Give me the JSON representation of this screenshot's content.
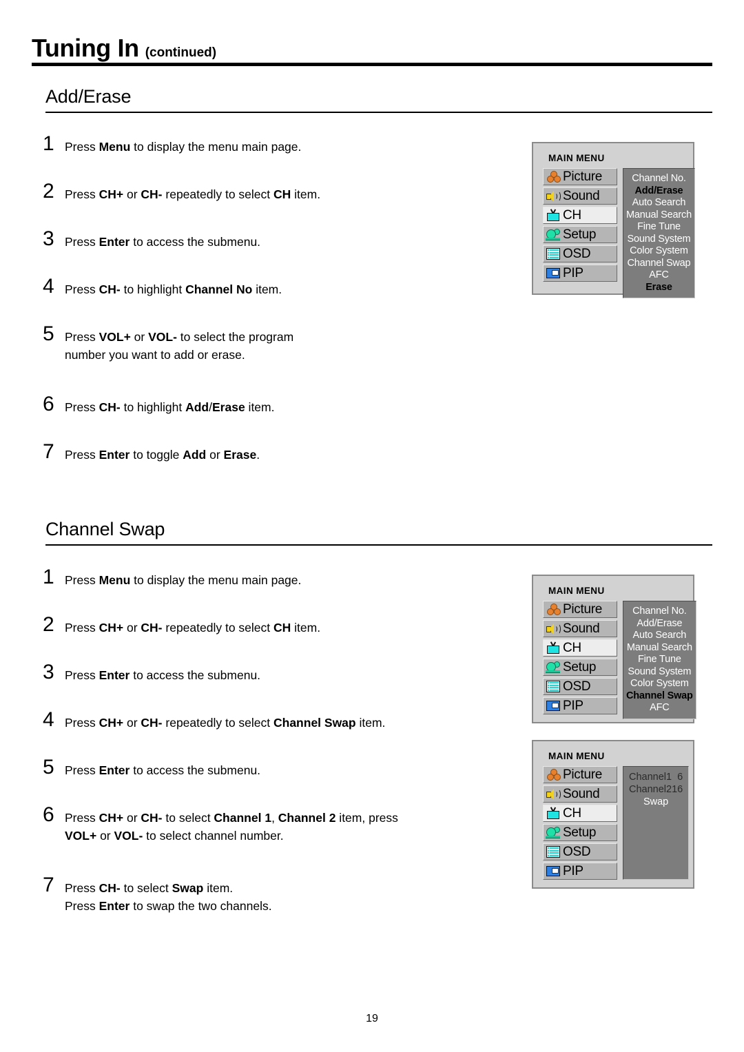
{
  "header": {
    "title": "Tuning In",
    "subtitle": "(continued)"
  },
  "sections": [
    {
      "id": "add-erase",
      "title": "Add/Erase",
      "steps": [
        {
          "num": "1",
          "html": "Press <b>Menu</b> to display the menu main page."
        },
        {
          "num": "2",
          "html": "Press <b>CH+</b> or <b>CH-</b> repeatedly to select <b>CH</b> item."
        },
        {
          "num": "3",
          "html": "Press <b>Enter</b> to access the submenu."
        },
        {
          "num": "4",
          "html": "Press <b>CH-</b> to highlight <b>Channel No</b> item."
        },
        {
          "num": "5",
          "html": "Press <b>VOL+</b> or <b>VOL-</b> to select the program",
          "line2": "number you want to add or erase."
        },
        {
          "num": "6",
          "html": "Press <b>CH-</b> to highlight <b>Add</b>/<b>Erase</b> item."
        },
        {
          "num": "7",
          "html": "Press <b>Enter</b> to toggle <b>Add</b> or <b>Erase</b>."
        }
      ]
    },
    {
      "id": "channel-swap",
      "title": "Channel Swap",
      "steps": [
        {
          "num": "1",
          "html": "Press <b>Menu</b> to display the menu main page."
        },
        {
          "num": "2",
          "html": "Press <b>CH+</b> or <b>CH-</b> repeatedly to select <b>CH</b> item."
        },
        {
          "num": "3",
          "html": "Press <b>Enter</b> to access the submenu."
        },
        {
          "num": "4",
          "html": "Press <b>CH+</b> or <b>CH-</b> repeatedly to select <b>Channel Swap</b> item."
        },
        {
          "num": "5",
          "html": "Press <b>Enter</b> to access the submenu."
        },
        {
          "num": "6",
          "html": "Press <b>CH+</b> or <b>CH-</b> to select <b>Channel 1</b>, <b>Channel 2</b> item, press",
          "line2": "<b>VOL+</b> or <b>VOL-</b> to select channel number."
        },
        {
          "num": "7",
          "html": "Press <b>CH-</b> to select <b>Swap</b> item.",
          "line2": "Press <b>Enter</b> to swap the two channels."
        }
      ]
    }
  ],
  "osd_menus": [
    {
      "id": "osd-add-erase",
      "title": "MAIN MENU",
      "buttons": [
        {
          "label": "Picture",
          "icon": "picture-icon",
          "selected": false
        },
        {
          "label": "Sound",
          "icon": "sound-icon",
          "selected": false
        },
        {
          "label": "CH",
          "icon": "ch-icon",
          "selected": true
        },
        {
          "label": "Setup",
          "icon": "setup-icon",
          "selected": false
        },
        {
          "label": "OSD",
          "icon": "osd-icon",
          "selected": false
        },
        {
          "label": "PIP",
          "icon": "pip-icon",
          "selected": false
        }
      ],
      "submenu": [
        {
          "label": "Channel No.",
          "highlighted": false
        },
        {
          "label": "Add/Erase",
          "highlighted": true
        },
        {
          "label": "Auto Search",
          "highlighted": false
        },
        {
          "label": "Manual Search",
          "highlighted": false
        },
        {
          "label": "Fine Tune",
          "highlighted": false
        },
        {
          "label": "Sound System",
          "highlighted": false
        },
        {
          "label": "Color System",
          "highlighted": false
        },
        {
          "label": "Channel Swap",
          "highlighted": false
        },
        {
          "label": "AFC",
          "highlighted": false
        },
        {
          "label": "Erase",
          "highlighted": true
        }
      ]
    },
    {
      "id": "osd-channel-swap",
      "title": "MAIN MENU",
      "buttons": [
        {
          "label": "Picture",
          "icon": "picture-icon",
          "selected": false
        },
        {
          "label": "Sound",
          "icon": "sound-icon",
          "selected": false
        },
        {
          "label": "CH",
          "icon": "ch-icon",
          "selected": true
        },
        {
          "label": "Setup",
          "icon": "setup-icon",
          "selected": false
        },
        {
          "label": "OSD",
          "icon": "osd-icon",
          "selected": false
        },
        {
          "label": "PIP",
          "icon": "pip-icon",
          "selected": false
        }
      ],
      "submenu": [
        {
          "label": "Channel No.",
          "highlighted": false
        },
        {
          "label": "Add/Erase",
          "highlighted": false
        },
        {
          "label": "Auto Search",
          "highlighted": false
        },
        {
          "label": "Manual Search",
          "highlighted": false
        },
        {
          "label": "Fine Tune",
          "highlighted": false
        },
        {
          "label": "Sound System",
          "highlighted": false
        },
        {
          "label": "Color System",
          "highlighted": false
        },
        {
          "label": "Channel Swap",
          "highlighted": true
        },
        {
          "label": "AFC",
          "highlighted": false
        }
      ]
    },
    {
      "id": "osd-swap-values",
      "title": "MAIN MENU",
      "buttons": [
        {
          "label": "Picture",
          "icon": "picture-icon",
          "selected": false
        },
        {
          "label": "Sound",
          "icon": "sound-icon",
          "selected": false
        },
        {
          "label": "CH",
          "icon": "ch-icon",
          "selected": true
        },
        {
          "label": "Setup",
          "icon": "setup-icon",
          "selected": false
        },
        {
          "label": "OSD",
          "icon": "osd-icon",
          "selected": false
        },
        {
          "label": "PIP",
          "icon": "pip-icon",
          "selected": false
        }
      ],
      "value_rows": [
        {
          "label": "Channel1",
          "value": "6"
        },
        {
          "label": "Channel2",
          "value": "16"
        }
      ],
      "action": "Swap"
    }
  ],
  "footer": {
    "page_number": "19"
  },
  "colors": {
    "panel_bg": "#d2d2d2",
    "button_bg": "#b5b5b5",
    "button_selected_bg": "#ededed",
    "submenu_bg": "#7d7d7d",
    "picture_icon": "#e8812e",
    "sound_icon": "#f2d21c",
    "ch_icon": "#1fe3e3",
    "setup_icon": "#20e0a8",
    "osd_icon": "#1fd8d8",
    "pip_icon": "#2f7fe0"
  }
}
